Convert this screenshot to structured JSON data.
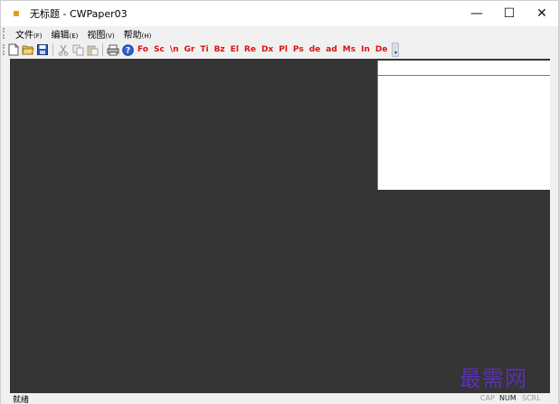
{
  "window": {
    "title": "无标题 - CWPaper03"
  },
  "title_buttons": {
    "minimize": "—",
    "maximize": "☐",
    "close": "✕"
  },
  "menu": [
    {
      "label": "文件",
      "accel": "(F)"
    },
    {
      "label": "编辑",
      "accel": "(E)"
    },
    {
      "label": "视图",
      "accel": "(V)"
    },
    {
      "label": "帮助",
      "accel": "(H)"
    }
  ],
  "toolbar": {
    "icons": [
      "new-file-icon",
      "open-folder-icon",
      "save-icon",
      "cut-icon",
      "copy-icon",
      "paste-icon",
      "print-icon",
      "help-icon"
    ],
    "text_buttons": [
      "Fo",
      "Sc",
      "\\n",
      "Gr",
      "Ti",
      "Bz",
      "El",
      "Re",
      "Dx",
      "Pl",
      "Ps",
      "de",
      "ad",
      "Ms",
      "In",
      "De"
    ]
  },
  "watermark": "最需网",
  "status": {
    "text": "就绪",
    "indicators": [
      "CAP",
      "NUM",
      "SCRL"
    ]
  },
  "colors": {
    "client_bg": "#353535",
    "toolbar_text": "#e01010",
    "watermark": "#5b2fb5"
  }
}
